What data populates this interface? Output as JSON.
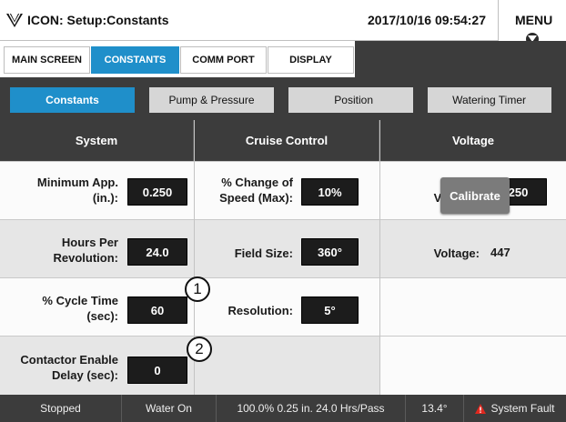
{
  "titlebar": {
    "logo_icon": "icon-logo",
    "title": "ICON: Setup:Constants",
    "datetime": "2017/10/16 09:54:27",
    "menu_label": "MENU"
  },
  "nav_tabs": [
    {
      "label": "MAIN SCREEN",
      "active": false
    },
    {
      "label": "CONSTANTS",
      "active": true
    },
    {
      "label": "COMM PORT",
      "active": false
    },
    {
      "label": "DISPLAY",
      "active": false
    }
  ],
  "sub_tabs": [
    {
      "label": "Constants",
      "active": true
    },
    {
      "label": "Pump & Pressure",
      "active": false
    },
    {
      "label": "Position",
      "active": false
    },
    {
      "label": "Watering Timer",
      "active": false
    }
  ],
  "columns": {
    "system": "System",
    "cruise": "Cruise Control",
    "voltage": "Voltage"
  },
  "system": {
    "min_app_label": "Minimum App. (in.):",
    "min_app_value": "0.250",
    "hours_label": "Hours Per Revolution:",
    "hours_value": "24.0",
    "cycle_label": "% Cycle Time (sec):",
    "cycle_value": "60",
    "contactor_label": "Contactor Enable Delay (sec):",
    "contactor_value": "0"
  },
  "cruise": {
    "speed_label": "% Change of Speed (Max):",
    "speed_value": "10%",
    "field_label": "Field Size:",
    "field_value": "360°",
    "res_label": "Resolution:",
    "res_value": "5°"
  },
  "voltage": {
    "low_label": "Low Voltage:",
    "low_value": "250",
    "voltage_label": "Voltage:",
    "voltage_value": "447",
    "calibrate_label": "Calibrate"
  },
  "callouts": [
    "1",
    "2"
  ],
  "status": {
    "state": "Stopped",
    "water": "Water On",
    "pass_info": "100.0%  0.25 in.  24.0 Hrs/Pass",
    "angle": "13.4°",
    "fault": "System Fault",
    "fault_color": "#e0281f"
  },
  "colors": {
    "accent": "#1f8fca",
    "dark": "#3c3c3c"
  }
}
